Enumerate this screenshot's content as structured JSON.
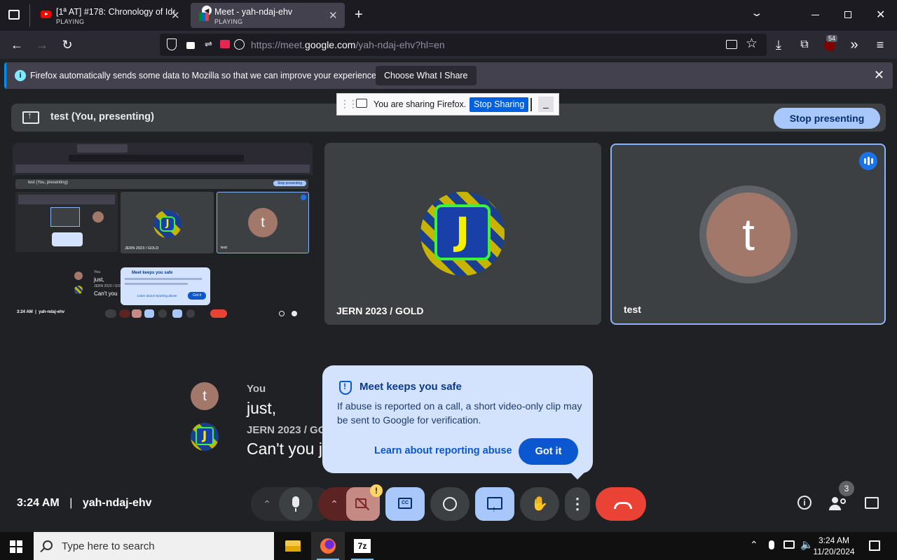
{
  "browser": {
    "tabs": [
      {
        "title": "[1ª AT] #178: Chronology of Ide",
        "status": "PLAYING"
      },
      {
        "title": "Meet - yah-ndaj-ehv",
        "status": "PLAYING"
      }
    ],
    "url_prefix": "https://meet.",
    "url_domain": "google.com",
    "url_path": "/yah-ndaj-ehv?hl=en",
    "notification_count": "54"
  },
  "notification": {
    "text": "Firefox automatically sends some data to Mozilla so that we can improve your experience.",
    "button": "Choose What I Share"
  },
  "sharing_bar": {
    "text": "You are sharing Firefox.",
    "stop": "Stop Sharing",
    "minimize": "_"
  },
  "meet": {
    "presenting_label": "test (You, presenting)",
    "stop_presenting": "Stop presenting",
    "tiles": [
      {
        "name": "JERN 2023 / GOLD",
        "avatar_letter": "J"
      },
      {
        "name": "test",
        "avatar_letter": "t"
      }
    ],
    "captions": [
      {
        "speaker": "You",
        "text": "just,",
        "avatar_letter": "t"
      },
      {
        "speaker": "JERN 2023 / GOLD",
        "text": "Can't you j",
        "avatar_letter": "J"
      }
    ],
    "safety": {
      "title": "Meet keeps you safe",
      "body": "If abuse is reported on a call, a short video-only clip may be sent to Google for verification.",
      "learn": "Learn about reporting abuse",
      "got_it": "Got it"
    },
    "time": "3:24 AM",
    "separator": "|",
    "meeting_code": "yah-ndaj-ehv",
    "participants_count": "3",
    "camera_warning": "!"
  },
  "mini": {
    "presenting_label": "test (You, presenting)",
    "stop": "Stop presenting",
    "tile1": "JERN 2023 / GOLD",
    "tile2": "test",
    "cap1_name": "You",
    "cap1": "just,",
    "cap2_name": "JERN 2023 / GOLD",
    "cap2": "Can't you",
    "safe_title": "Meet keeps you safe",
    "learn": "Learn about reporting abuse",
    "got": "Got it",
    "time": "3:24 AM  |  yah-ndaj-ehv"
  },
  "taskbar": {
    "search_placeholder": "Type here to search",
    "time": "3:24 AM",
    "date": "11/20/2024",
    "app_7z": "7z"
  },
  "colors": {
    "accent": "#8ab4f8",
    "leave": "#ea4335",
    "popup": "#d3e3fd"
  }
}
